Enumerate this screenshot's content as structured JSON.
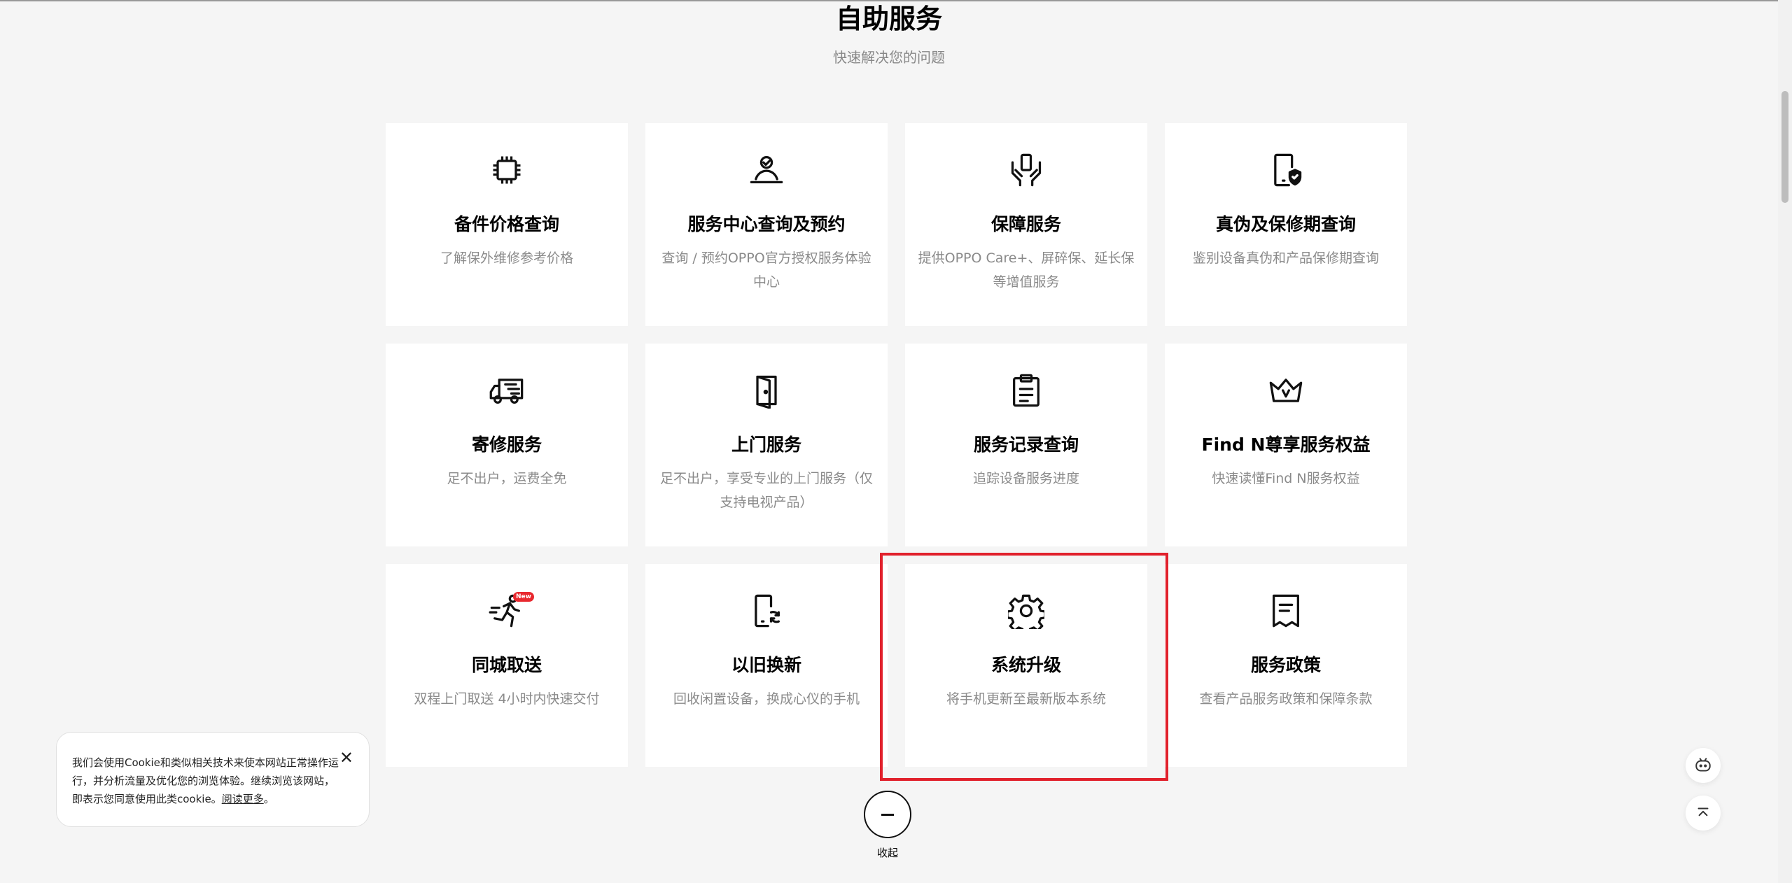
{
  "section": {
    "title": "自助服务",
    "subtitle": "快速解决您的问题"
  },
  "cards": [
    {
      "icon": "chip-icon",
      "title": "备件价格查询",
      "desc": "了解保外维修参考价格"
    },
    {
      "icon": "service-person-icon",
      "title": "服务中心查询及预约",
      "desc": "查询 / 预约OPPO官方授权服务体验中心"
    },
    {
      "icon": "hands-phone-icon",
      "title": "保障服务",
      "desc": "提供OPPO Care+、屏碎保、延长保等增值服务"
    },
    {
      "icon": "phone-shield-icon",
      "title": "真伪及保修期查询",
      "desc": "鉴别设备真伪和产品保修期查询"
    },
    {
      "icon": "truck-icon",
      "title": "寄修服务",
      "desc": "足不出户，运费全免"
    },
    {
      "icon": "door-icon",
      "title": "上门服务",
      "desc": "足不出户，享受专业的上门服务（仅支持电视产品）"
    },
    {
      "icon": "clipboard-icon",
      "title": "服务记录查询",
      "desc": "追踪设备服务进度"
    },
    {
      "icon": "crown-icon",
      "title": "Find N尊享服务权益",
      "desc": "快速读懂Find N服务权益"
    },
    {
      "icon": "runner-icon",
      "title": "同城取送",
      "desc": "双程上门取送 4小时内快速交付",
      "badge": "New"
    },
    {
      "icon": "phone-recycle-icon",
      "title": "以旧换新",
      "desc": "回收闲置设备，换成心仪的手机"
    },
    {
      "icon": "gear-icon",
      "title": "系统升级",
      "desc": "将手机更新至最新版本系统"
    },
    {
      "icon": "receipt-icon",
      "title": "服务政策",
      "desc": "查看产品服务政策和保障条款"
    }
  ],
  "collapse": {
    "label": "收起",
    "icon": "minus-icon"
  },
  "cookie": {
    "text": "我们会使用Cookie和类似相关技术来使本网站正常操作运行，并分析流量及优化您的浏览体验。继续浏览该网站，即表示您同意使用此类cookie。",
    "link": "阅读更多",
    "end": "。"
  },
  "floating": {
    "chat_icon": "chatbot-icon",
    "top_icon": "back-to-top-icon"
  },
  "colors": {
    "highlight": "#e1212c",
    "badge": "#e8282e",
    "background": "#f5f5f5"
  }
}
